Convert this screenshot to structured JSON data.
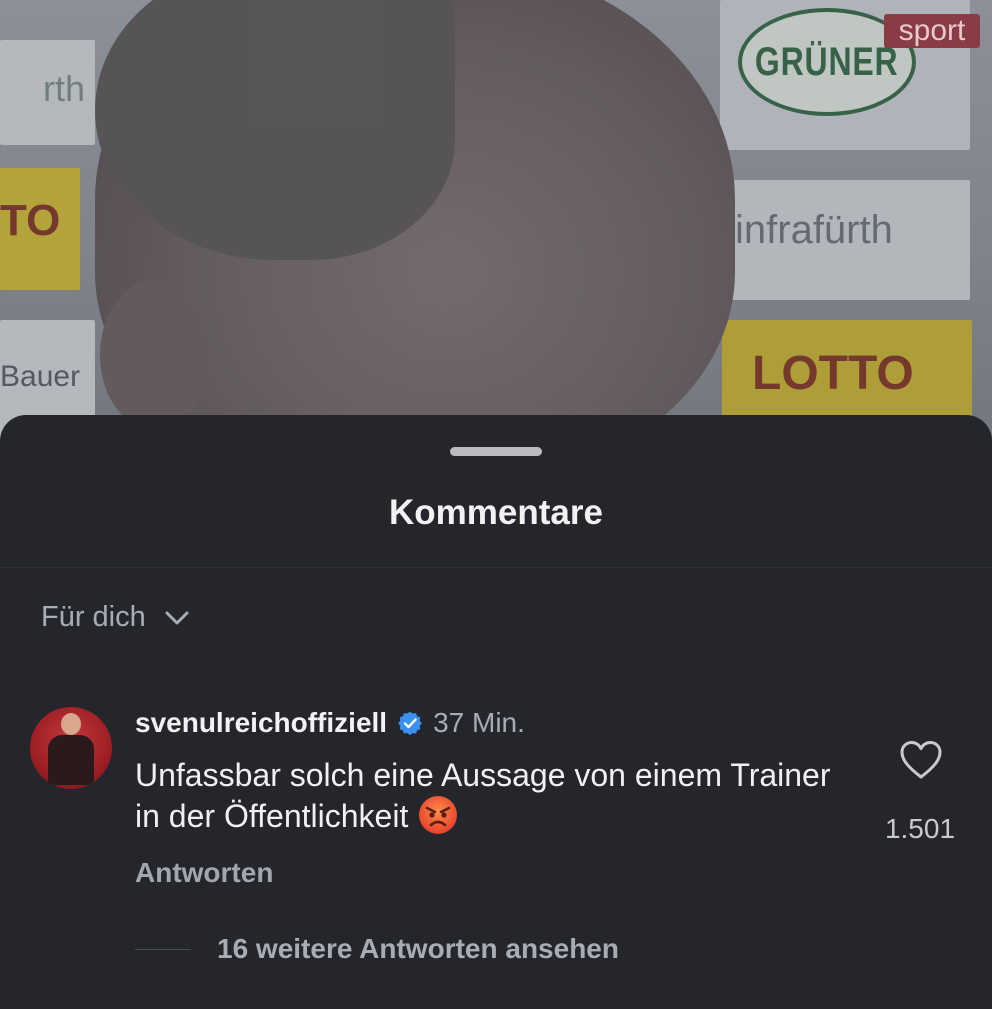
{
  "video": {
    "sky_badge": "sport",
    "boards": {
      "left_top": "rth",
      "left_yellow": "TO",
      "left_bottom": "Bauer",
      "right_top": "GRÜNER",
      "right_mid": "infrafürth",
      "right_yellow": "LOTTO"
    }
  },
  "sheet": {
    "title": "Kommentare",
    "filter": {
      "label": "Für dich",
      "icon": "chevron-down-icon"
    }
  },
  "comment": {
    "username": "svenulreichoffiziell",
    "verified_icon": "verified-badge-icon",
    "timestamp": "37 Min.",
    "text": "Unfassbar solch eine Aussage von einem Trainer in der Öffentlichkeit",
    "emoji": "angry-face-emoji",
    "reply_label": "Antworten",
    "like_icon": "heart-icon",
    "like_count": "1.501"
  },
  "more_replies": {
    "label": "16 weitere Antworten ansehen"
  },
  "colors": {
    "sheet_bg": "#24262c",
    "text_primary": "#f2f2f3",
    "text_secondary": "#a9acb2",
    "verified_blue": "#3a8ff0"
  }
}
